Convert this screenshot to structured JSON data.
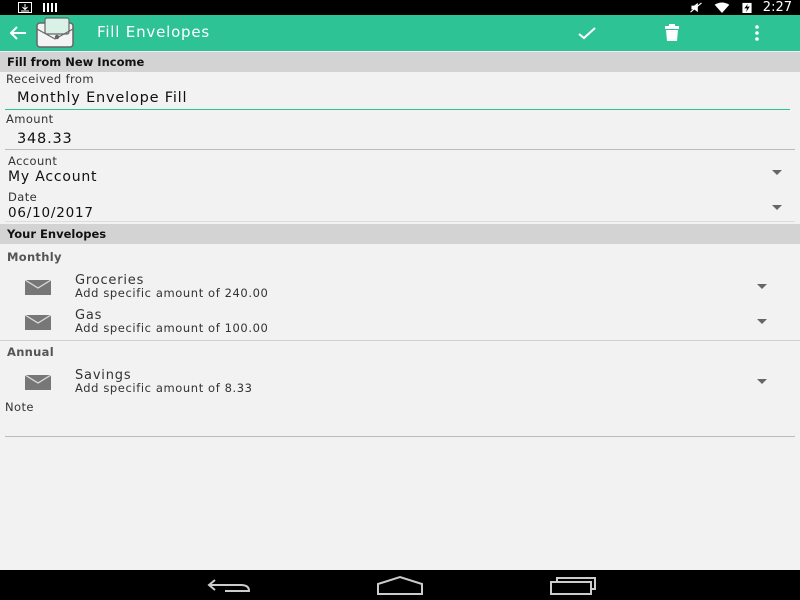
{
  "status_bar": {
    "time": "2:27"
  },
  "app_bar": {
    "title": "Fill Envelopes"
  },
  "form": {
    "section_title": "Fill from New Income",
    "received_from": {
      "label": "Received from",
      "value": "Monthly Envelope Fill"
    },
    "amount": {
      "label": "Amount",
      "value": "348.33"
    },
    "account": {
      "label": "Account",
      "value": "My Account"
    },
    "date": {
      "label": "Date",
      "value": "06/10/2017"
    }
  },
  "envelopes": {
    "section_title": "Your Envelopes",
    "groups": [
      {
        "label": "Monthly",
        "items": [
          {
            "name": "Groceries",
            "detail": "Add specific amount of 240.00"
          },
          {
            "name": "Gas",
            "detail": "Add specific amount of 100.00"
          }
        ]
      },
      {
        "label": "Annual",
        "items": [
          {
            "name": "Savings",
            "detail": "Add specific amount of 8.33"
          }
        ]
      }
    ]
  },
  "note": {
    "label": "Note",
    "value": ""
  },
  "colors": {
    "accent": "#2ec394",
    "section_header": "#d3d3d3",
    "background": "#f2f2f2"
  }
}
